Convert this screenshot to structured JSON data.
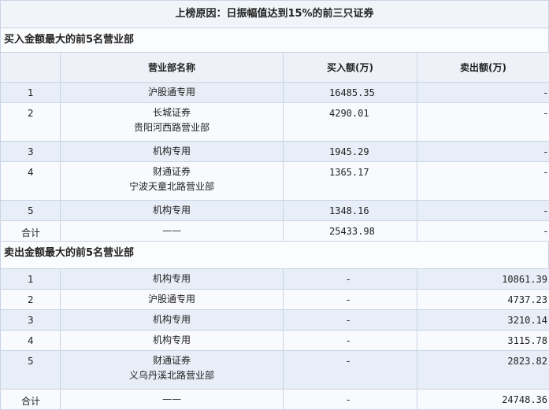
{
  "title": "上榜原因：日振幅值达到15%的前三只证券",
  "columns": {
    "name": "营业部名称",
    "buy": "买入额(万)",
    "sell": "卖出额(万)"
  },
  "buy_section": {
    "heading": "买入金额最大的前5名营业部",
    "rows": [
      {
        "rank": "1",
        "name_line1": "沪股通专用",
        "name_line2": "",
        "buy": "16485.35",
        "sell": "-"
      },
      {
        "rank": "2",
        "name_line1": "长城证券",
        "name_line2": "贵阳河西路营业部",
        "buy": "4290.01",
        "sell": "-"
      },
      {
        "rank": "3",
        "name_line1": "机构专用",
        "name_line2": "",
        "buy": "1945.29",
        "sell": "-"
      },
      {
        "rank": "4",
        "name_line1": "财通证券",
        "name_line2": "宁波天童北路营业部",
        "buy": "1365.17",
        "sell": "-"
      },
      {
        "rank": "5",
        "name_line1": "机构专用",
        "name_line2": "",
        "buy": "1348.16",
        "sell": "-"
      }
    ],
    "total": {
      "label": "合计",
      "name": "——",
      "buy": "25433.98",
      "sell": "-"
    }
  },
  "sell_section": {
    "heading": "卖出金额最大的前5名营业部",
    "rows": [
      {
        "rank": "1",
        "name_line1": "机构专用",
        "name_line2": "",
        "buy": "-",
        "sell": "10861.39"
      },
      {
        "rank": "2",
        "name_line1": "沪股通专用",
        "name_line2": "",
        "buy": "-",
        "sell": "4737.23"
      },
      {
        "rank": "3",
        "name_line1": "机构专用",
        "name_line2": "",
        "buy": "-",
        "sell": "3210.14"
      },
      {
        "rank": "4",
        "name_line1": "机构专用",
        "name_line2": "",
        "buy": "-",
        "sell": "3115.78"
      },
      {
        "rank": "5",
        "name_line1": "财通证券",
        "name_line2": "义乌丹溪北路营业部",
        "buy": "-",
        "sell": "2823.82"
      }
    ],
    "total": {
      "label": "合计",
      "name": "——",
      "buy": "-",
      "sell": "24748.36"
    }
  }
}
